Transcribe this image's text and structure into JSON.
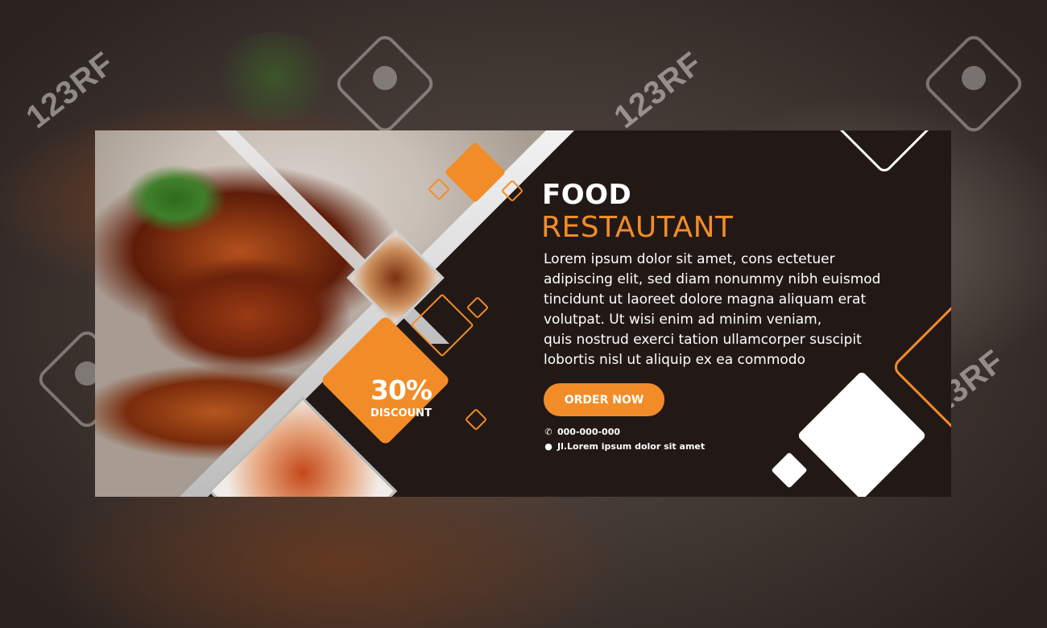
{
  "watermark": {
    "text": "123RF"
  },
  "banner": {
    "title_line1": "FOOD",
    "title_line2": "RESTAUTANT",
    "body_lines": [
      "Lorem ipsum dolor sit amet, cons ectetuer",
      "adipiscing elit, sed diam nonummy nibh euismod",
      "tincidunt ut laoreet dolore magna aliquam erat",
      "volutpat. Ut wisi enim ad minim veniam,",
      "quis nostrud exerci tation ullamcorper suscipit",
      "lobortis nisl ut aliquip ex ea commodo"
    ],
    "cta_label": "ORDER NOW",
    "phone": "000-000-000",
    "address": "Jl.Lorem ipsum dolor sit amet",
    "discount_percent": "30%",
    "discount_label": "DISCOUNT",
    "icons": {
      "phone": "phone-icon",
      "location": "location-pin-icon"
    },
    "colors": {
      "accent": "#f28c28",
      "dark": "#221916",
      "white": "#ffffff"
    }
  }
}
